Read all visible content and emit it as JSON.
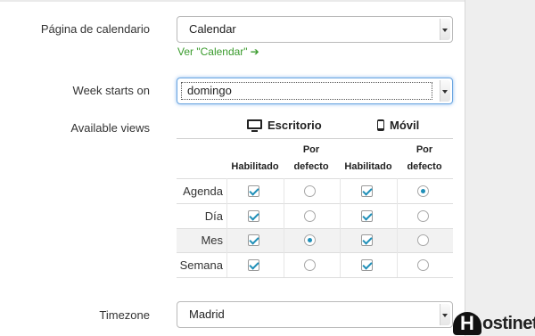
{
  "calendar_page": {
    "label": "Página de calendario",
    "value": "Calendar",
    "link": "Ver \"Calendar\"",
    "link_arrow": "➔"
  },
  "week_start": {
    "label": "Week starts on",
    "value": "domingo"
  },
  "available_views": {
    "label": "Available views",
    "desktop_label": "Escritorio",
    "mobile_label": "Móvil",
    "col_enabled": "Habilitado",
    "col_default": "Por defecto",
    "rows": [
      {
        "name": "Agenda",
        "desktop_enabled": true,
        "desktop_default": false,
        "mobile_enabled": true,
        "mobile_default": true
      },
      {
        "name": "Día",
        "desktop_enabled": true,
        "desktop_default": false,
        "mobile_enabled": true,
        "mobile_default": false
      },
      {
        "name": "Mes",
        "desktop_enabled": true,
        "desktop_default": true,
        "mobile_enabled": true,
        "mobile_default": false
      },
      {
        "name": "Semana",
        "desktop_enabled": true,
        "desktop_default": false,
        "mobile_enabled": true,
        "mobile_default": false
      }
    ]
  },
  "timezone": {
    "label": "Timezone",
    "value": "Madrid"
  },
  "watermark": {
    "letter": "H",
    "text": "ostinet"
  },
  "colors": {
    "accent_link": "#3a9b2d",
    "check_blue": "#1f8fb8",
    "focus_glow": "#6aa5e0"
  }
}
